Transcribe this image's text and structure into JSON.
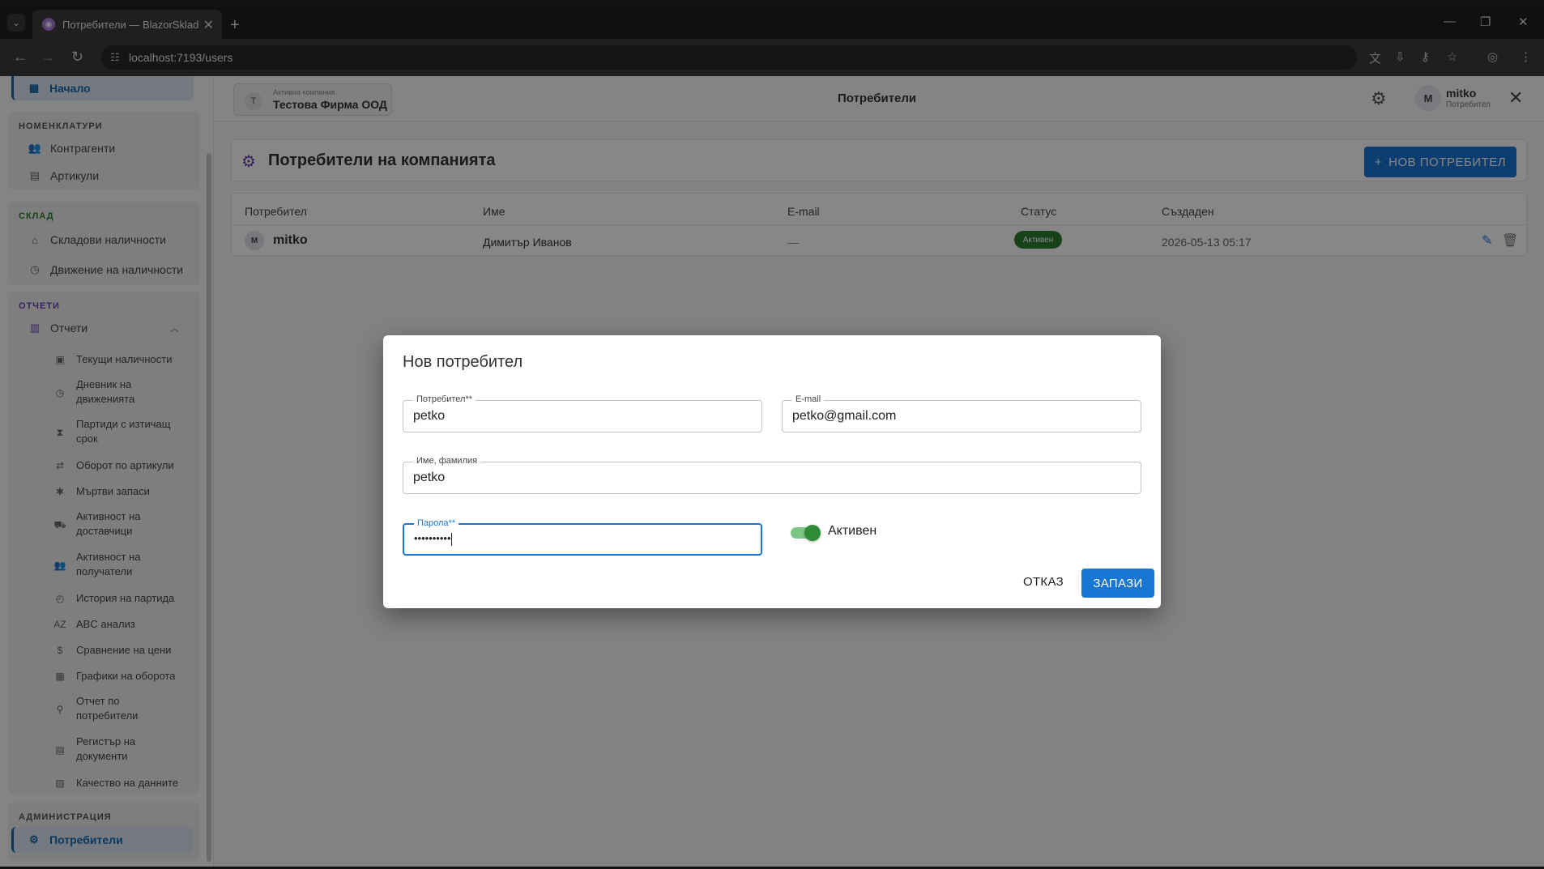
{
  "browser": {
    "tab_title": "Потребители — BlazorSklad",
    "url": "localhost:7193/users"
  },
  "sidebar": {
    "home": "Начало",
    "groups": [
      {
        "title": "НОМЕНКЛАТУРИ",
        "items": [
          "Контрагенти",
          "Артикули"
        ]
      },
      {
        "title": "СКЛАД",
        "items": [
          "Складови наличности",
          "Движение на наличности"
        ]
      },
      {
        "title": "ОТЧЕТИ",
        "items": [
          "Отчети"
        ]
      },
      {
        "title": "АДМИНИСТРАЦИЯ",
        "items": [
          "Потребители"
        ]
      }
    ],
    "reports": [
      {
        "l1": "Текущи наличности",
        "l2": ""
      },
      {
        "l1": "Дневник на",
        "l2": "движенията"
      },
      {
        "l1": "Партиди с изтичащ",
        "l2": "срок"
      },
      {
        "l1": "Оборот по артикули",
        "l2": ""
      },
      {
        "l1": "Мъртви запаси",
        "l2": ""
      },
      {
        "l1": "Активност на",
        "l2": "доставчици"
      },
      {
        "l1": "Активност на",
        "l2": "получатели"
      },
      {
        "l1": "История на партида",
        "l2": ""
      },
      {
        "l1": "ABC анализ",
        "l2": ""
      },
      {
        "l1": "Сравнение на цени",
        "l2": ""
      },
      {
        "l1": "Графики на оборота",
        "l2": ""
      },
      {
        "l1": "Отчет по",
        "l2": "потребители"
      },
      {
        "l1": "Регистър на",
        "l2": "документи"
      },
      {
        "l1": "Качество на данните",
        "l2": ""
      }
    ]
  },
  "header": {
    "company_label": "Активна компания",
    "company_initial": "Т",
    "company_name": "Тестова Фирма ООД",
    "page_title": "Потребители",
    "user_initial": "M",
    "user_name": "mitko",
    "user_role": "Потребител"
  },
  "main": {
    "title": "Потребители на компанията",
    "new_button": "НОВ ПОТРЕБИТЕЛ",
    "columns": [
      "Потребител",
      "Име",
      "E-mail",
      "Статус",
      "Създаден"
    ],
    "rows": [
      {
        "initial": "M",
        "username": "mitko",
        "name": "Димитър Иванов",
        "email": "—",
        "status": "Активен",
        "created": "2026-05-13 05:17"
      }
    ]
  },
  "dialog": {
    "title": "Нов потребител",
    "username_label": "Потребител**",
    "username_value": "petko",
    "email_label": "E-mail",
    "email_value": "petko@gmail.com",
    "fullname_label": "Име, фамилия",
    "fullname_value": "petko",
    "password_label": "Парола**",
    "password_value": "••••••••••",
    "active_label": "Активен",
    "active": true,
    "cancel": "ОТКАЗ",
    "save": "ЗАПАЗИ"
  },
  "colors": {
    "primary": "#1976d2",
    "success": "#2e7d32",
    "accent": "#6a3fb5"
  }
}
